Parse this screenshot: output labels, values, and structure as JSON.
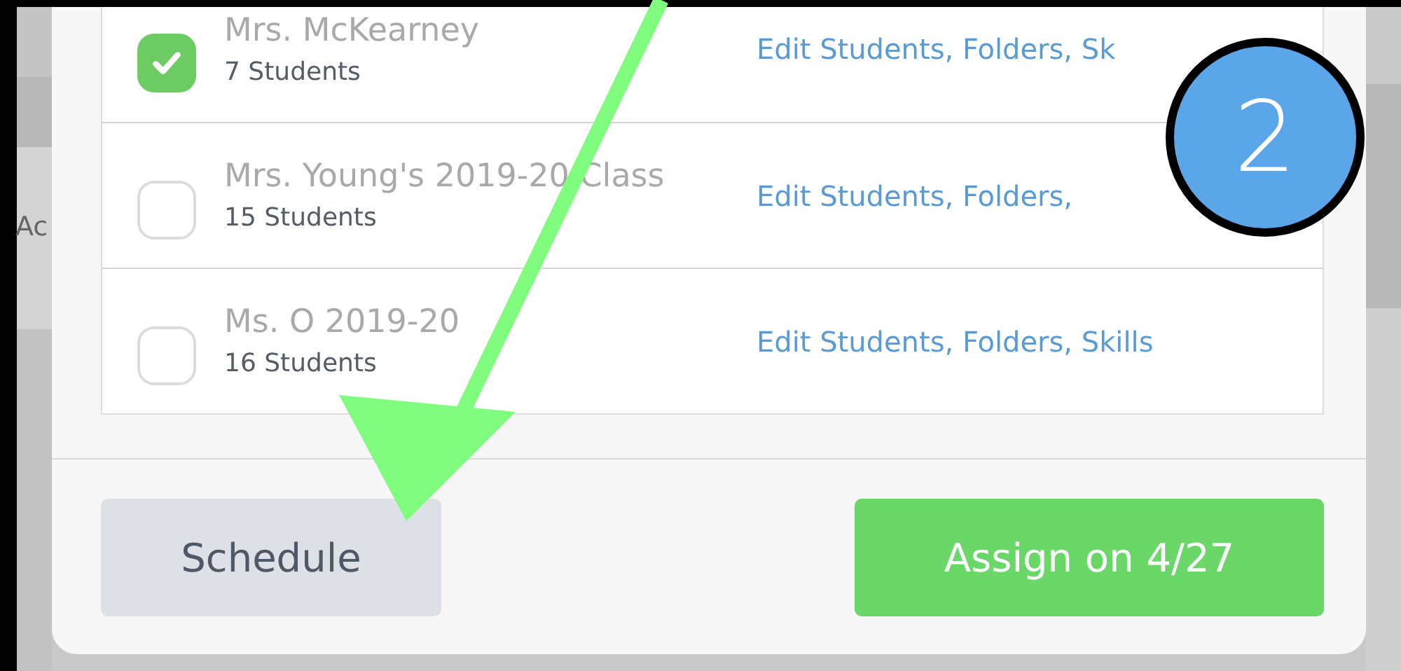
{
  "backdrop": {
    "text": "Ac"
  },
  "classes": [
    {
      "name": "Mrs. McKearney",
      "count": "7 Students",
      "checked": true,
      "link": "Edit Students, Folders, Sk"
    },
    {
      "name": "Mrs. Young's 2019-20 Class",
      "count": "15 Students",
      "checked": false,
      "link": "Edit Students, Folders,"
    },
    {
      "name": "Ms. O 2019-20",
      "count": "16 Students",
      "checked": false,
      "link": "Edit Students, Folders, Skills"
    }
  ],
  "buttons": {
    "schedule": "Schedule",
    "assign": "Assign on 4/27"
  },
  "annotation": {
    "number": "2"
  }
}
